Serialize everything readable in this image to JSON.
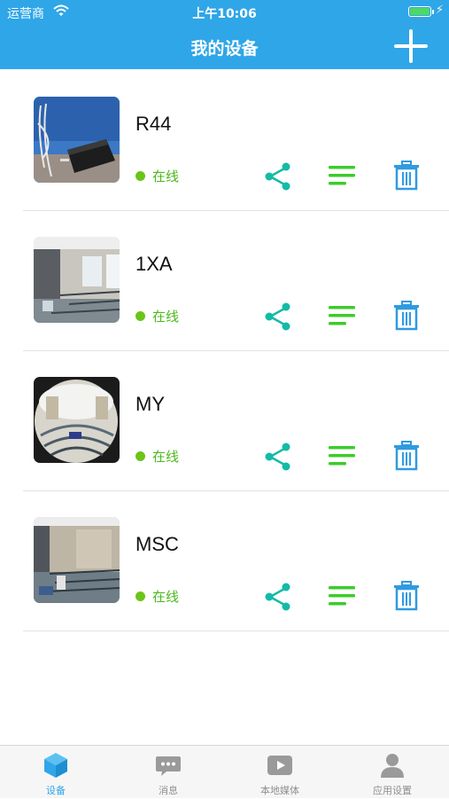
{
  "status_bar": {
    "carrier": "运营商",
    "time": "上午10:06"
  },
  "nav": {
    "title": "我的设备",
    "add_icon": "plus-icon"
  },
  "colors": {
    "primary": "#2fa6e8",
    "online": "#4cb81c",
    "share_icon": "#13bba6",
    "list_icon": "#3bcc2a",
    "delete_icon": "#2f9be0"
  },
  "devices": [
    {
      "name": "R44",
      "status": "在线",
      "thumbnail": "camera-view-desk-cables"
    },
    {
      "name": "1XA",
      "status": "在线",
      "thumbnail": "camera-view-office-room"
    },
    {
      "name": "MY",
      "status": "在线",
      "thumbnail": "camera-view-fisheye-office"
    },
    {
      "name": "MSC",
      "status": "在线",
      "thumbnail": "camera-view-office-desks"
    }
  ],
  "tabs": [
    {
      "label": "设备",
      "icon": "cube-icon",
      "active": true
    },
    {
      "label": "消息",
      "icon": "chat-bubble-icon",
      "active": false
    },
    {
      "label": "本地媒体",
      "icon": "play-video-icon",
      "active": false
    },
    {
      "label": "应用设置",
      "icon": "user-icon",
      "active": false
    }
  ]
}
